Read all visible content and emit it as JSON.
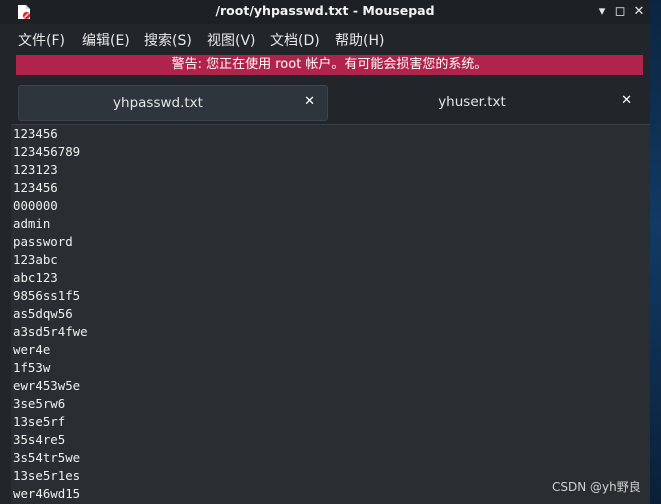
{
  "window": {
    "title": "/root/yhpasswd.txt - Mousepad",
    "minimize_glyph": "▾",
    "maximize_glyph": "◻",
    "close_glyph": "✕"
  },
  "menu": [
    {
      "label": "文件(F)"
    },
    {
      "label": "编辑(E)"
    },
    {
      "label": "搜索(S)"
    },
    {
      "label": "视图(V)"
    },
    {
      "label": "文档(D)"
    },
    {
      "label": "帮助(H)"
    }
  ],
  "warning": "警告: 您正在使用 root 帐户。有可能会损害您的系统。",
  "tabs": [
    {
      "label": "yhpasswd.txt",
      "close": "✕",
      "active": true
    },
    {
      "label": "yhuser.txt",
      "close": "✕",
      "active": false
    }
  ],
  "editor_lines": [
    "123456",
    "123456789",
    "123123",
    "123456",
    "000000",
    "admin",
    "password",
    "123abc",
    "abc123",
    "9856ss1f5",
    "as5dqw56",
    "a3sd5r4fwe",
    "wer4e",
    "1f53w",
    "ewr453w5e",
    "3se5rw6",
    "13se5rf",
    "35s4re5",
    "3s54tr5we",
    "13se5r1es",
    "wer46wd15"
  ],
  "watermark": "CSDN @yh野良",
  "colors": {
    "warning_bg": "#b0234a",
    "editor_bg": "#2a2e33"
  }
}
